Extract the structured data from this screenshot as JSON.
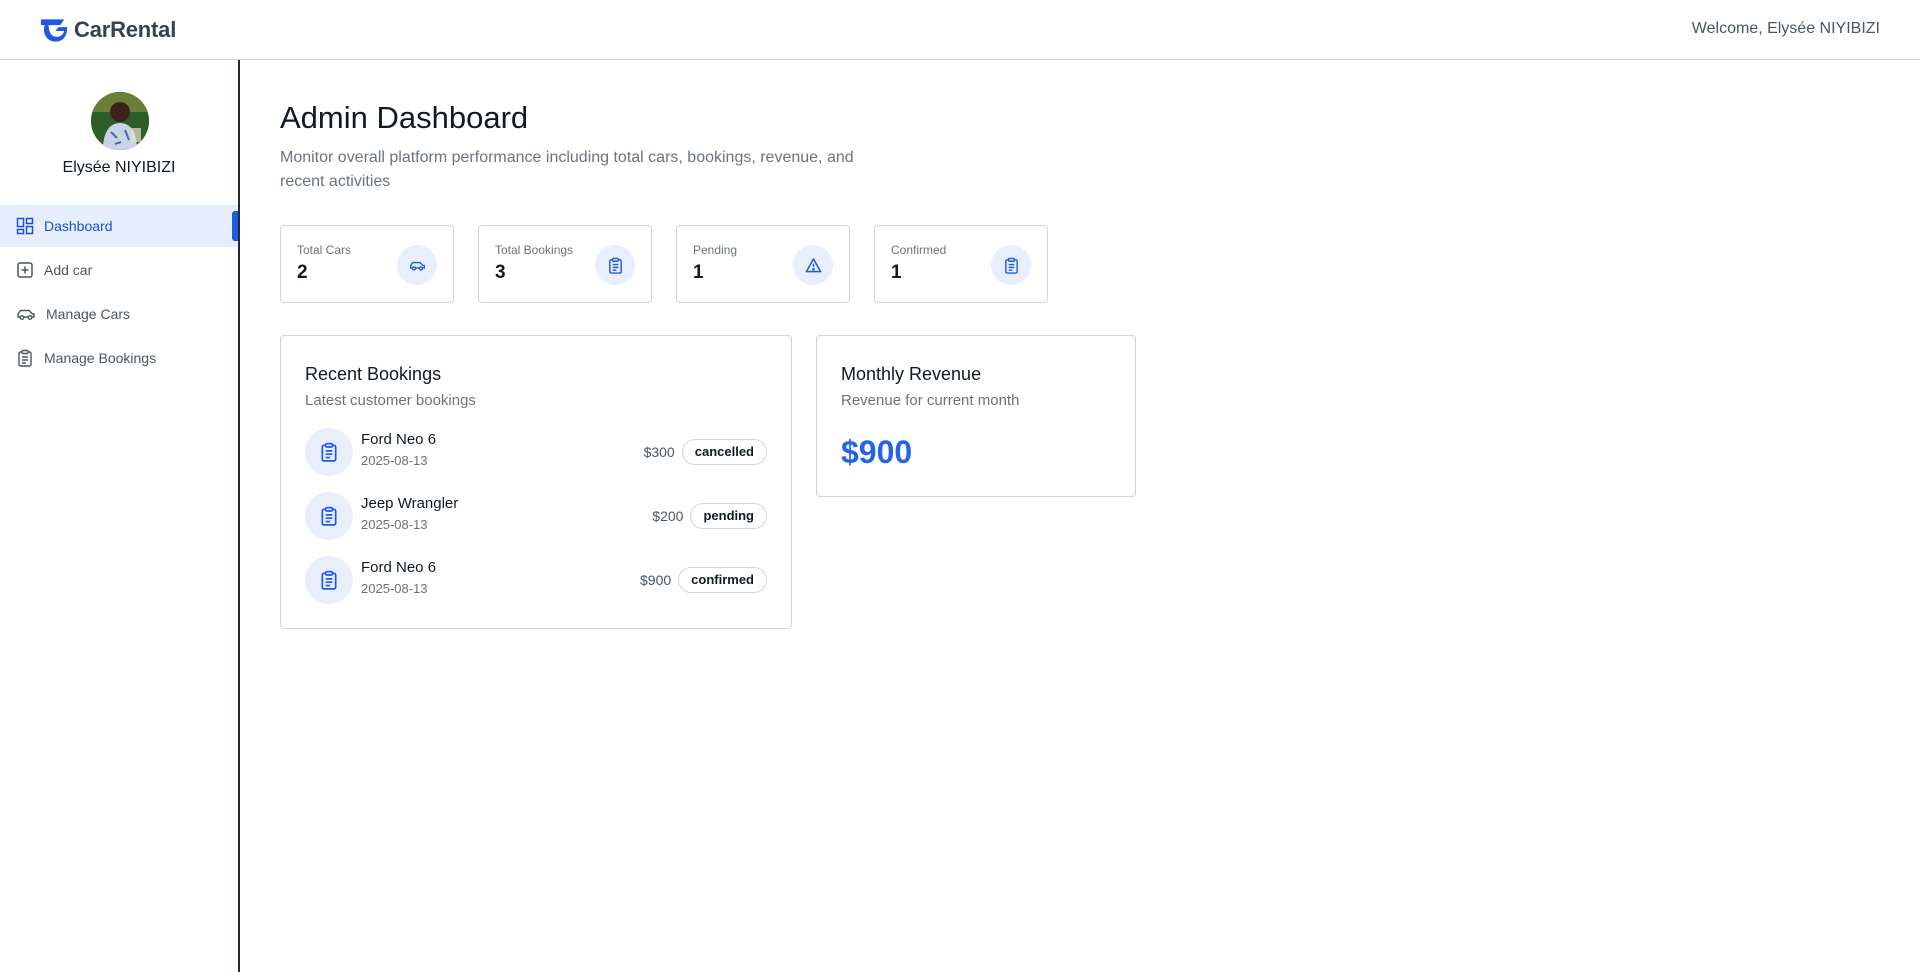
{
  "header": {
    "brand": "CarRental",
    "welcome": "Welcome, Elysée NIYIBIZI"
  },
  "sidebar": {
    "user_name": "Elysée NIYIBIZI",
    "items": [
      {
        "label": "Dashboard",
        "icon": "dashboard-icon",
        "active": true
      },
      {
        "label": "Add car",
        "icon": "plus-square-icon",
        "active": false
      },
      {
        "label": "Manage Cars",
        "icon": "car-icon",
        "active": false
      },
      {
        "label": "Manage Bookings",
        "icon": "clipboard-icon",
        "active": false
      }
    ]
  },
  "main": {
    "title": "Admin Dashboard",
    "subtitle": "Monitor overall platform performance including total cars, bookings, revenue, and recent activities",
    "stats": [
      {
        "label": "Total Cars",
        "value": "2",
        "icon": "car-icon"
      },
      {
        "label": "Total Bookings",
        "value": "3",
        "icon": "clipboard-icon"
      },
      {
        "label": "Pending",
        "value": "1",
        "icon": "warning-icon"
      },
      {
        "label": "Confirmed",
        "value": "1",
        "icon": "clipboard-icon"
      }
    ],
    "recent_bookings": {
      "title": "Recent Bookings",
      "subtitle": "Latest customer bookings",
      "items": [
        {
          "car": "Ford Neo 6",
          "date": "2025-08-13",
          "amount": "$300",
          "status": "cancelled"
        },
        {
          "car": "Jeep Wrangler",
          "date": "2025-08-13",
          "amount": "$200",
          "status": "pending"
        },
        {
          "car": "Ford Neo 6",
          "date": "2025-08-13",
          "amount": "$900",
          "status": "confirmed"
        }
      ]
    },
    "monthly_revenue": {
      "title": "Monthly Revenue",
      "subtitle": "Revenue for current month",
      "value": "$900"
    }
  },
  "colors": {
    "accent": "#2563eb",
    "active_bg": "#e6eefb",
    "icon_bg": "#e8eefb",
    "border": "#d1d5db"
  }
}
